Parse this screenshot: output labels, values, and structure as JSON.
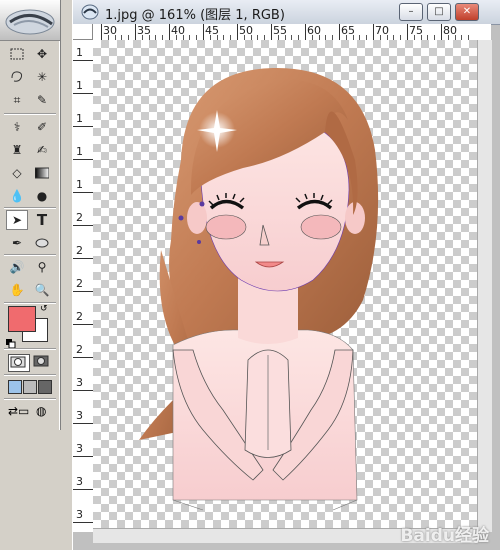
{
  "document": {
    "title": "1.jpg @ 161% (图层 1, RGB)",
    "zoom": "161%",
    "layer": "图层 1",
    "mode": "RGB"
  },
  "ruler": {
    "top_ticks": [
      "30",
      "35",
      "40",
      "45",
      "50",
      "55",
      "60",
      "65",
      "70",
      "75",
      "80"
    ],
    "left_ticks": [
      "1",
      "1",
      "1",
      "1",
      "1",
      "2",
      "2",
      "2",
      "2",
      "2",
      "3",
      "3",
      "3",
      "3",
      "3"
    ]
  },
  "toolbox": {
    "foreground_color": "#f06b6e",
    "background_color": "#ffffff",
    "tools": [
      "marquee-icon",
      "move-icon",
      "lasso-icon",
      "magic-wand-icon",
      "crop-icon",
      "slice-icon",
      "healing-brush-icon",
      "brush-icon",
      "clone-stamp-icon",
      "history-brush-icon",
      "eraser-icon",
      "gradient-icon",
      "blur-icon",
      "dodge-icon",
      "path-selection-icon",
      "type-icon",
      "pen-icon",
      "shape-icon",
      "notes-icon",
      "eyedropper-icon",
      "hand-icon",
      "zoom-icon"
    ]
  },
  "window_buttons": {
    "minimize": "–",
    "maximize": "□",
    "close": "✕"
  },
  "watermark": "Baidu经验"
}
